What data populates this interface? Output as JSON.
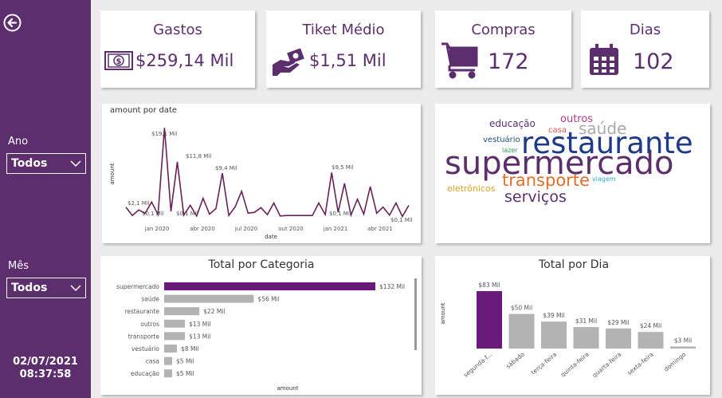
{
  "sidebar": {
    "year_label": "Ano",
    "year_value": "Todos",
    "month_label": "Mês",
    "month_value": "Todos",
    "date": "02/07/2021",
    "time": "08:37:58",
    "colors": {
      "bg": "#5c2e6e",
      "fg": "#ffffff"
    }
  },
  "kpis": [
    {
      "title": "Gastos",
      "value": "$259,14 Mil",
      "icon": "money-icon"
    },
    {
      "title": "Tiket Médio",
      "value": "$1,51 Mil",
      "icon": "hand-money-icon"
    },
    {
      "title": "Compras",
      "value": "172",
      "icon": "cart-icon"
    },
    {
      "title": "Dias",
      "value": "102",
      "icon": "calendar-icon"
    }
  ],
  "line_chart": {
    "title": "amount por date",
    "xlabel": "date",
    "ylabel": "amount",
    "x_ticks": [
      "jan 2020",
      "abr 2020",
      "jul 2020",
      "out 2020",
      "jan 2021",
      "abr 2021"
    ],
    "labels": [
      "$19,1 Mil",
      "$11,8 Mil",
      "$9,4 Mil",
      "$9,5 Mil",
      "$2,1 Mil",
      "$0,1 Mil",
      "$0,1 Mil",
      "$0,1 Mil",
      "$0,1 Mil"
    ]
  },
  "word_cloud": {
    "words": [
      {
        "text": "supermercado",
        "color": "#5c2e6e"
      },
      {
        "text": "restaurante",
        "color": "#1f3a8a"
      },
      {
        "text": "transporte",
        "color": "#e46c2b"
      },
      {
        "text": "serviços",
        "color": "#5c2e6e"
      },
      {
        "text": "saúde",
        "color": "#aaaaaa"
      },
      {
        "text": "outros",
        "color": "#b03a8a"
      },
      {
        "text": "educação",
        "color": "#5c2e6e"
      },
      {
        "text": "casa",
        "color": "#d9534f"
      },
      {
        "text": "vestuário",
        "color": "#1f4e79"
      },
      {
        "text": "lazer",
        "color": "#2e9e4f"
      },
      {
        "text": "eletrônicos",
        "color": "#d9a521"
      },
      {
        "text": "viagem",
        "color": "#2aa6c9"
      }
    ]
  },
  "chart_data": [
    {
      "type": "line",
      "title": "amount por date",
      "xlabel": "date",
      "ylabel": "amount",
      "x_ticks": [
        "jan 2020",
        "abr 2020",
        "jul 2020",
        "out 2020",
        "jan 2021",
        "abr 2021"
      ],
      "annotations": [
        "$19,1 Mil",
        "$11,8 Mil",
        "$9,4 Mil",
        "$9,5 Mil",
        "$2,1 Mil",
        "$0,1 Mil"
      ],
      "values": [
        2.1,
        0.3,
        1.5,
        0.8,
        3.2,
        0.5,
        19.1,
        1.2,
        11.8,
        0.4,
        2.5,
        0.2,
        4.0,
        0.6,
        1.8,
        9.4,
        0.3,
        2.2,
        5.5,
        0.8,
        1.0,
        2.0,
        0.5,
        3.0,
        0.2,
        0.3,
        0.3,
        0.3,
        0.3,
        0.3,
        3.0,
        0.5,
        9.5,
        1.0,
        7.2,
        0.4,
        3.8,
        0.6,
        6.5,
        0.8,
        2.1,
        0.4,
        3.0,
        0.1,
        2.5
      ]
    },
    {
      "type": "bar",
      "title": "Total por Categoria",
      "xlabel": "amount",
      "categories": [
        "supermercado",
        "saúde",
        "restaurante",
        "outros",
        "transporte",
        "vestuário",
        "casa",
        "educação"
      ],
      "values": [
        132,
        56,
        22,
        13,
        13,
        8,
        5,
        5
      ],
      "labels": [
        "$132 Mil",
        "$56 Mil",
        "$22 Mil",
        "$13 Mil",
        "$13 Mil",
        "$8 Mil",
        "$5 Mil",
        "$5 Mil"
      ],
      "highlight_color": "#6a1a7a",
      "bar_color": "#b3b3b3"
    },
    {
      "type": "bar",
      "title": "Total por Dia",
      "ylabel": "amount",
      "categories": [
        "segunda-f...",
        "sábado",
        "terça-feira",
        "quinta-feira",
        "quarta-feira",
        "sexta-feira",
        "domingo"
      ],
      "values": [
        83,
        50,
        39,
        31,
        29,
        24,
        3
      ],
      "labels": [
        "$83 Mil",
        "$50 Mil",
        "$39 Mil",
        "$31 Mil",
        "$29 Mil",
        "$24 Mil",
        "$3 Mil"
      ],
      "highlight_color": "#6a1a7a",
      "bar_color": "#b3b3b3"
    }
  ]
}
